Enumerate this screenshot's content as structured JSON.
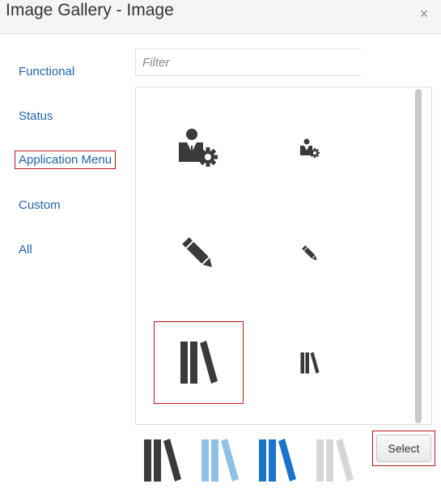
{
  "dialog": {
    "title": "Image Gallery - Image",
    "close_label": "×"
  },
  "nav": {
    "items": [
      {
        "label": "Functional"
      },
      {
        "label": "Status"
      },
      {
        "label": "Application Menu",
        "selected": true
      },
      {
        "label": "Custom"
      },
      {
        "label": "All"
      }
    ]
  },
  "filter": {
    "placeholder": "Filter",
    "value": ""
  },
  "gallery": {
    "images": [
      {
        "icon": "user-gear-icon",
        "size": "large"
      },
      {
        "icon": "user-gear-icon",
        "size": "small"
      },
      {
        "icon": "pencil-icon",
        "size": "large"
      },
      {
        "icon": "pencil-icon",
        "size": "small"
      },
      {
        "icon": "library-books-icon",
        "size": "large",
        "selected": true
      },
      {
        "icon": "library-books-icon",
        "size": "small"
      }
    ]
  },
  "variants": [
    {
      "icon": "library-books-icon",
      "color": "#3a3a3a"
    },
    {
      "icon": "library-books-icon",
      "color": "#8ec0e8"
    },
    {
      "icon": "library-books-icon",
      "color": "#1b74c8"
    },
    {
      "icon": "library-books-icon",
      "color": "#d6d6d6"
    }
  ],
  "actions": {
    "select_label": "Select"
  },
  "colors": {
    "link": "#1f64a8",
    "selection_border": "#c0141b",
    "icon": "#3a3a3a"
  }
}
